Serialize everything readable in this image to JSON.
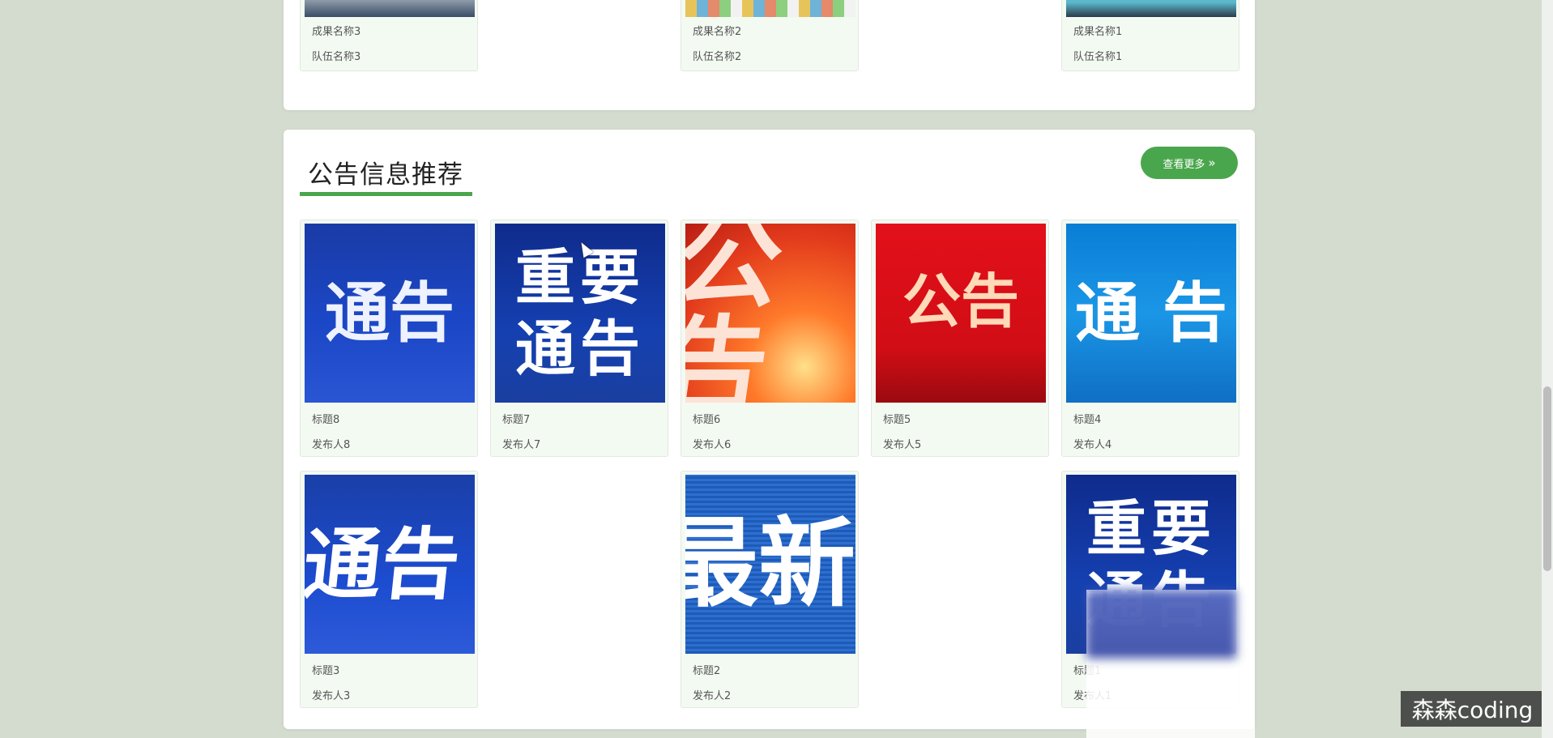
{
  "top_section": {
    "cards": [
      {
        "name": "成果名称3",
        "team": "队伍名称3"
      },
      {
        "name": "成果名称2",
        "team": "队伍名称2"
      },
      {
        "name": "成果名称1",
        "team": "队伍名称1"
      }
    ]
  },
  "notices": {
    "title": "公告信息推荐",
    "more_label": "查看更多",
    "more_icon": "double-chevron-right-icon",
    "accent_color": "#4aa64d",
    "cards": [
      {
        "image_text": [
          "通告"
        ],
        "title": "标题8",
        "author": "发布人8"
      },
      {
        "image_text": [
          "重要",
          "通告"
        ],
        "title": "标题7",
        "author": "发布人7"
      },
      {
        "image_text": [
          "公告"
        ],
        "title": "标题6",
        "author": "发布人6"
      },
      {
        "image_text": [
          "公告"
        ],
        "title": "标题5",
        "author": "发布人5"
      },
      {
        "image_text": [
          "通 告"
        ],
        "title": "标题4",
        "author": "发布人4"
      },
      {
        "image_text": [
          "通告"
        ],
        "title": "标题3",
        "author": "发布人3"
      },
      {
        "image_text": [
          "最新"
        ],
        "title": "标题2",
        "author": "发布人2"
      },
      {
        "image_text": [
          "重要",
          "通告"
        ],
        "title": "标题1",
        "author": "发布人1"
      }
    ]
  },
  "watermark": {
    "label": "森森coding"
  }
}
